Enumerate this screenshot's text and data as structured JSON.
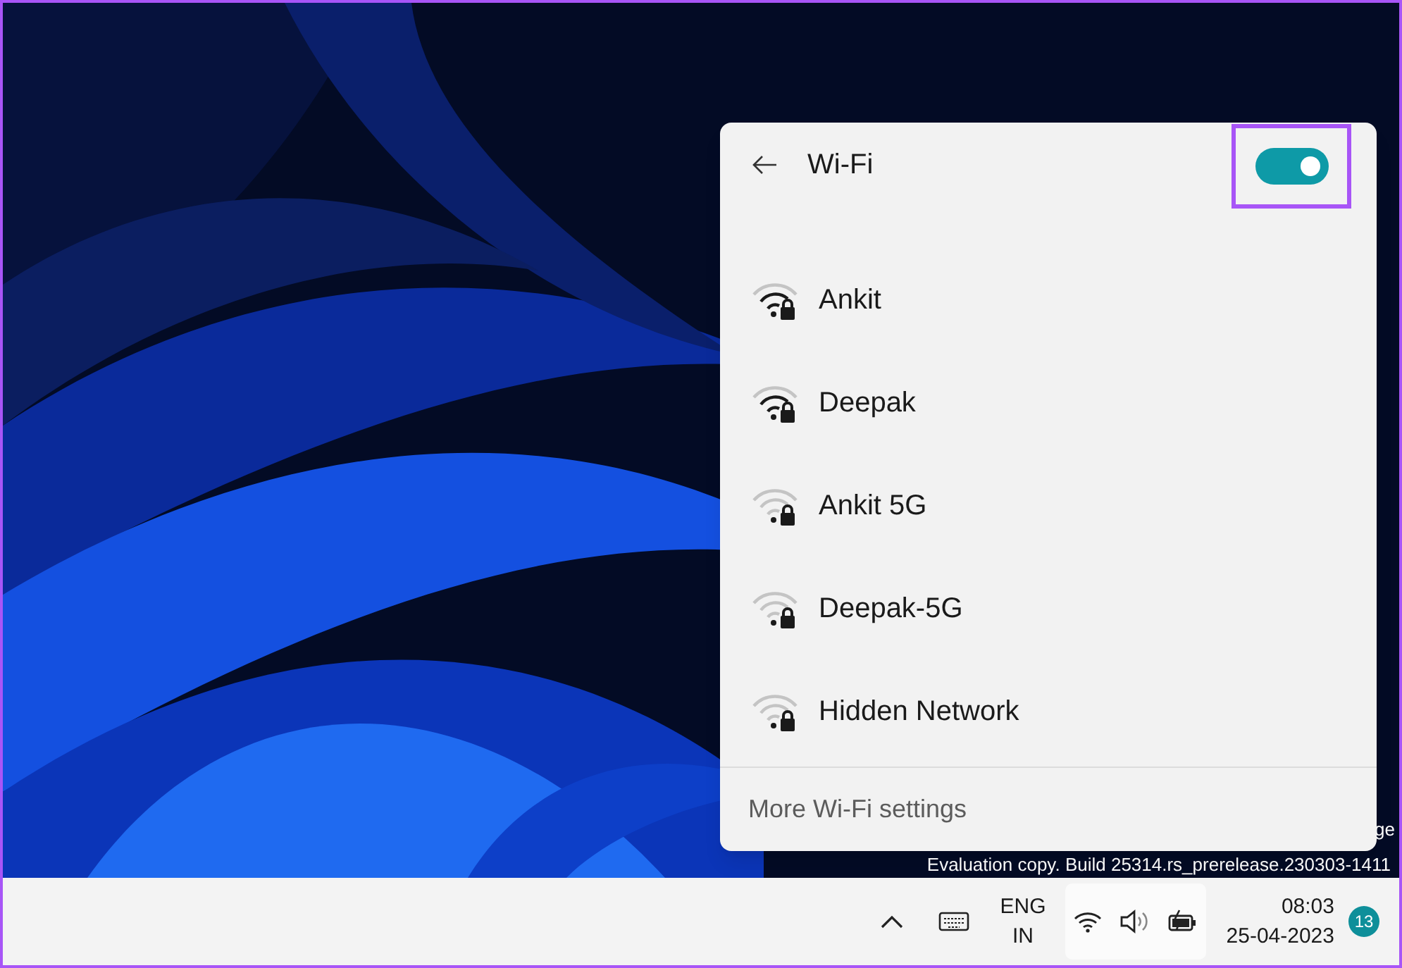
{
  "desktop": {
    "watermark_lines": [
      "ge",
      "Evaluation copy. Build 25314.rs_prerelease.230303-1411"
    ]
  },
  "wifi_flyout": {
    "title": "Wi-Fi",
    "wifi_on": true,
    "highlighted": true,
    "networks": [
      {
        "name": "Ankit",
        "weak_signal": false,
        "secured": true
      },
      {
        "name": "Deepak",
        "weak_signal": false,
        "secured": true
      },
      {
        "name": "Ankit 5G",
        "weak_signal": true,
        "secured": true
      },
      {
        "name": "Deepak-5G",
        "weak_signal": true,
        "secured": true
      },
      {
        "name": "Hidden Network",
        "weak_signal": true,
        "secured": true
      }
    ],
    "footer_link": "More Wi-Fi settings"
  },
  "taskbar": {
    "language": [
      "ENG",
      "IN"
    ],
    "time": "08:03",
    "date": "25-04-2023",
    "notification_count": "13"
  }
}
